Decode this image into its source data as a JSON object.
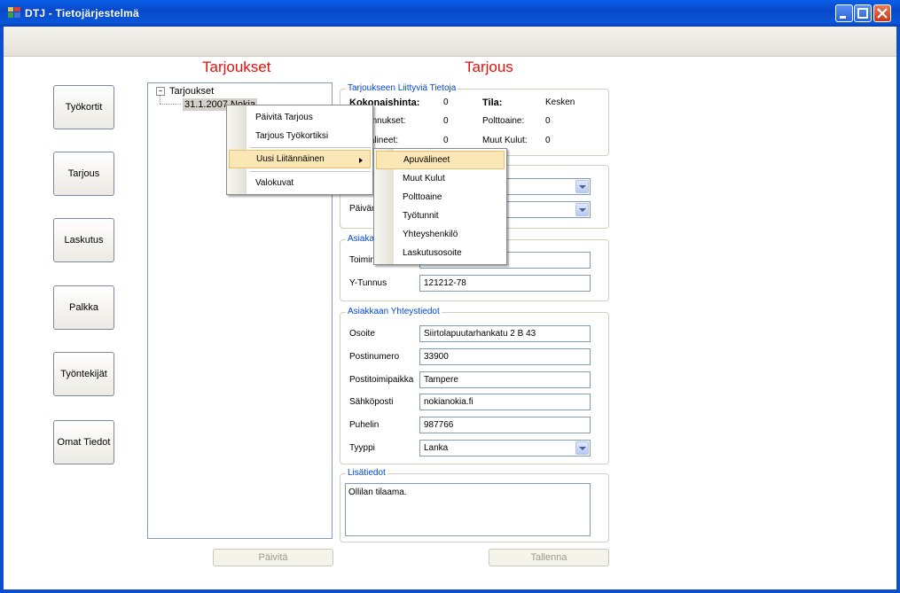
{
  "window": {
    "title": "DTJ - Tietojärjestelmä"
  },
  "headings": {
    "left": "Tarjoukset",
    "right": "Tarjous"
  },
  "nav": [
    {
      "label": "Työkortit"
    },
    {
      "label": "Tarjous"
    },
    {
      "label": "Laskutus"
    },
    {
      "label": "Palkka"
    },
    {
      "label": "Työntekijät"
    },
    {
      "label": "Omat Tiedot"
    }
  ],
  "tree": {
    "root": "Tarjoukset",
    "child": "31.1.2007 Nokia"
  },
  "context_menu": {
    "items": [
      "Päivitä Tarjous",
      "Tarjous Työkortiksi",
      "Uusi Liitännäinen",
      "Valokuvat"
    ],
    "highlighted": "Uusi Liitännäinen"
  },
  "submenu": {
    "items": [
      "Apuvälineet",
      "Muut Kulut",
      "Polttoaine",
      "Työtunnit",
      "Yhteyshenkilö",
      "Laskutusosoite"
    ],
    "highlighted": "Apuvälineet"
  },
  "info_group": {
    "legend": "Tarjoukseen Liittyviä Tietoja",
    "kokonaishinta_label": "Kokonaishinta:",
    "kokonaishinta_value": "0",
    "tila_label": "Tila:",
    "tila_value": "Kesken",
    "kustannukset_label": "Kustannukset:",
    "kustannukset_value": "0",
    "polttoaine_label": "Polttoaine:",
    "polttoaine_value": "0",
    "apuvalineet_label": "Apuvälineet:",
    "apuvalineet_value": "0",
    "muut_kulut_label": "Muut Kulut:",
    "muut_kulut_value": "0"
  },
  "group2": {
    "paivamaara_label": "Päivämäärä"
  },
  "customer_group": {
    "legend": "Asiakas",
    "toiminimi_label": "Toiminimi",
    "toiminimi_value": "",
    "ytunnus_label": "Y-Tunnus",
    "ytunnus_value": "121212-78"
  },
  "contact_group": {
    "legend": "Asiakkaan Yhteystiedot",
    "osoite_label": "Osoite",
    "osoite_value": "Siirtolapuutarhankatu 2 B 43",
    "postinumero_label": "Postinumero",
    "postinumero_value": "33900",
    "postitoimipaikka_label": "Postitoimipaikka",
    "postitoimipaikka_value": "Tampere",
    "sahkoposti_label": "Sähköposti",
    "sahkoposti_value": "nokianokia.fi",
    "puhelin_label": "Puhelin",
    "puhelin_value": "987766",
    "tyyppi_label": "Tyyppi",
    "tyyppi_value": "Lanka"
  },
  "notes_group": {
    "legend": "Lisätiedot",
    "value": "Ollilan tilaama."
  },
  "buttons": {
    "paivita": "Päivitä",
    "tallenna": "Tallenna"
  },
  "colors": {
    "heading": "#e3120b",
    "legend": "#0046d5",
    "titlebar": "#0a5ee8",
    "menu_highlight": "#fbe7b5"
  }
}
